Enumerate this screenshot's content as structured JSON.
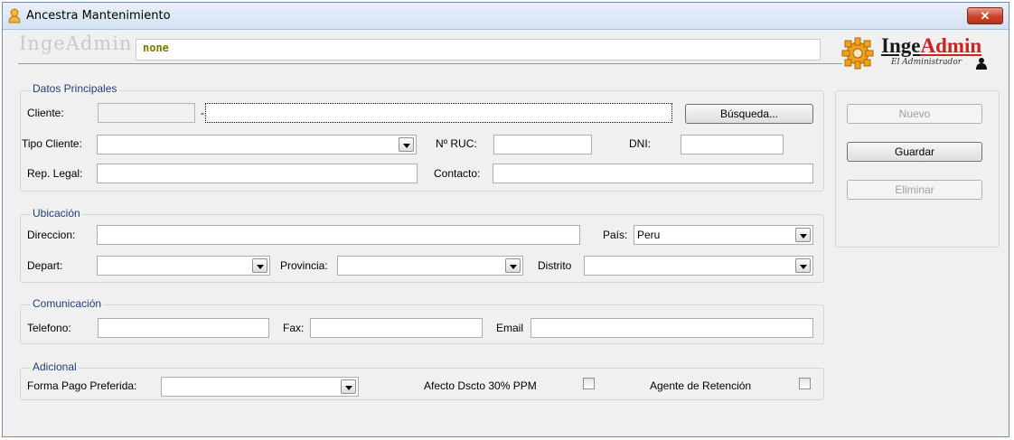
{
  "window": {
    "title": "Ancestra Mantenimiento",
    "close_symbol": "✕"
  },
  "header": {
    "brand_faded": "IngeAdmin",
    "user_value": "none",
    "logo": {
      "part1": "Inge",
      "part2": "Admin",
      "subtitle": "El Administrador"
    }
  },
  "datos": {
    "legend": "Datos Principales",
    "cliente_label": "Cliente:",
    "cliente_code": "",
    "cliente_separator": "-",
    "cliente_name": "",
    "busqueda_button": "Búsqueda...",
    "tipo_cliente_label": "Tipo Cliente:",
    "tipo_cliente_value": "",
    "ruc_label": "Nº RUC:",
    "ruc_value": "",
    "dni_label": "DNI:",
    "dni_value": "",
    "rep_legal_label": "Rep. Legal:",
    "rep_legal_value": "",
    "contacto_label": "Contacto:",
    "contacto_value": ""
  },
  "ubicacion": {
    "legend": "Ubicación",
    "direccion_label": "Direccion:",
    "direccion_value": "",
    "pais_label": "País:",
    "pais_value": "Peru",
    "depart_label": "Depart:",
    "depart_value": "",
    "provincia_label": "Provincia:",
    "provincia_value": "",
    "distrito_label": "Distrito",
    "distrito_value": ""
  },
  "comunicacion": {
    "legend": "Comunicación",
    "telefono_label": "Telefono:",
    "telefono_value": "",
    "fax_label": "Fax:",
    "fax_value": "",
    "email_label": "Email",
    "email_value": ""
  },
  "adicional": {
    "legend": "Adicional",
    "forma_pago_label": "Forma Pago Preferida:",
    "forma_pago_value": "",
    "afecto_label": "Afecto Dscto 30% PPM",
    "afecto_checked": false,
    "agente_label": "Agente de Retención",
    "agente_checked": false
  },
  "actions": {
    "nuevo": "Nuevo",
    "guardar": "Guardar",
    "eliminar": "Eliminar"
  },
  "colors": {
    "legend_text": "#1d3f7a",
    "close_button": "#c9432b",
    "logo_admin": "#d02020",
    "user_text": "#7b7b00"
  }
}
